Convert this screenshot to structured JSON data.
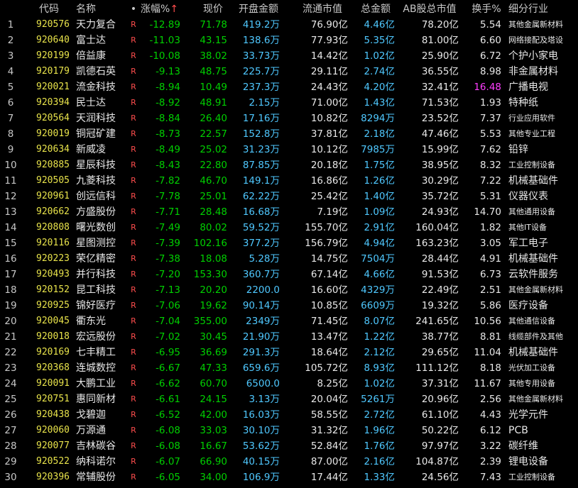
{
  "header": {
    "index": "",
    "code": "代码",
    "name": "名称",
    "dot": "•",
    "change_pct": "涨幅%",
    "change_arrow": "↑",
    "price": "现价",
    "open_amount": "开盘金额",
    "float_mv": "流通市值",
    "total_amount": "总金额",
    "ab_total_mv": "AB股总市值",
    "turnover": "换手%",
    "industry": "细分行业"
  },
  "colors": {
    "code": "#e8e34b",
    "down": "#00d000",
    "amount": "#4fc8ff",
    "neutral": "#e8e8e8",
    "rzrq_flag": "#ff4d4d",
    "highlight": "#ff3dff",
    "background": "#000000"
  },
  "rows": [
    {
      "idx": "1",
      "code": "920576",
      "name": "天力复合",
      "flag": "R",
      "chg": "-12.89",
      "price": "71.78",
      "open": "419.2万",
      "fmv": "76.90亿",
      "amt": "4.46亿",
      "abmv": "78.20亿",
      "turn": "5.54",
      "ind": "其他金属新材料"
    },
    {
      "idx": "2",
      "code": "920640",
      "name": "富士达",
      "flag": "R",
      "chg": "-11.03",
      "price": "43.15",
      "open": "138.6万",
      "fmv": "77.93亿",
      "amt": "5.35亿",
      "abmv": "81.00亿",
      "turn": "6.60",
      "ind": "网络接配及塔设"
    },
    {
      "idx": "3",
      "code": "920199",
      "name": "倍益康",
      "flag": "R",
      "chg": "-10.08",
      "price": "38.02",
      "open": "33.73万",
      "fmv": "14.42亿",
      "amt": "1.02亿",
      "abmv": "25.90亿",
      "turn": "6.72",
      "ind": "个护小家电"
    },
    {
      "idx": "4",
      "code": "920179",
      "name": "凯德石英",
      "flag": "R",
      "chg": "-9.13",
      "price": "48.75",
      "open": "225.7万",
      "fmv": "29.11亿",
      "amt": "2.74亿",
      "abmv": "36.55亿",
      "turn": "8.98",
      "ind": "非金属材料"
    },
    {
      "idx": "5",
      "code": "920021",
      "name": "流金科技",
      "flag": "R",
      "chg": "-8.94",
      "price": "10.49",
      "open": "237.3万",
      "fmv": "24.43亿",
      "amt": "4.20亿",
      "abmv": "32.41亿",
      "turn": "16.48",
      "ind": "广播电视"
    },
    {
      "idx": "6",
      "code": "920394",
      "name": "民士达",
      "flag": "R",
      "chg": "-8.92",
      "price": "48.91",
      "open": "2.15万",
      "fmv": "71.00亿",
      "amt": "1.43亿",
      "abmv": "71.53亿",
      "turn": "1.93",
      "ind": "特种纸"
    },
    {
      "idx": "7",
      "code": "920564",
      "name": "天润科技",
      "flag": "R",
      "chg": "-8.84",
      "price": "26.40",
      "open": "17.16万",
      "fmv": "10.82亿",
      "amt": "8294万",
      "abmv": "23.52亿",
      "turn": "7.37",
      "ind": "行业应用软件"
    },
    {
      "idx": "8",
      "code": "920019",
      "name": "铜冠矿建",
      "flag": "R",
      "chg": "-8.73",
      "price": "22.57",
      "open": "152.8万",
      "fmv": "37.81亿",
      "amt": "2.18亿",
      "abmv": "47.46亿",
      "turn": "5.53",
      "ind": "其他专业工程"
    },
    {
      "idx": "9",
      "code": "920634",
      "name": "新威凌",
      "flag": "R",
      "chg": "-8.49",
      "price": "25.02",
      "open": "31.23万",
      "fmv": "10.12亿",
      "amt": "7985万",
      "abmv": "15.99亿",
      "turn": "7.62",
      "ind": "铅锌"
    },
    {
      "idx": "10",
      "code": "920885",
      "name": "星辰科技",
      "flag": "R",
      "chg": "-8.43",
      "price": "22.80",
      "open": "87.85万",
      "fmv": "20.18亿",
      "amt": "1.75亿",
      "abmv": "38.95亿",
      "turn": "8.32",
      "ind": "工业控制设备"
    },
    {
      "idx": "11",
      "code": "920505",
      "name": "九菱科技",
      "flag": "R",
      "chg": "-7.82",
      "price": "46.70",
      "open": "149.1万",
      "fmv": "16.86亿",
      "amt": "1.26亿",
      "abmv": "30.29亿",
      "turn": "7.22",
      "ind": "机械基础件"
    },
    {
      "idx": "12",
      "code": "920961",
      "name": "创远信科",
      "flag": "R",
      "chg": "-7.78",
      "price": "25.01",
      "open": "62.22万",
      "fmv": "25.42亿",
      "amt": "1.40亿",
      "abmv": "35.72亿",
      "turn": "5.31",
      "ind": "仪器仪表"
    },
    {
      "idx": "13",
      "code": "920662",
      "name": "方盛股份",
      "flag": "R",
      "chg": "-7.71",
      "price": "28.48",
      "open": "16.68万",
      "fmv": "7.19亿",
      "amt": "1.09亿",
      "abmv": "24.93亿",
      "turn": "14.70",
      "ind": "其他通用设备"
    },
    {
      "idx": "14",
      "code": "920808",
      "name": "曙光数创",
      "flag": "R",
      "chg": "-7.49",
      "price": "80.02",
      "open": "59.52万",
      "fmv": "155.70亿",
      "amt": "2.91亿",
      "abmv": "160.04亿",
      "turn": "1.82",
      "ind": "其他IT设备"
    },
    {
      "idx": "15",
      "code": "920116",
      "name": "星图测控",
      "flag": "R",
      "chg": "-7.39",
      "price": "102.16",
      "open": "377.2万",
      "fmv": "156.79亿",
      "amt": "4.94亿",
      "abmv": "163.23亿",
      "turn": "3.05",
      "ind": "军工电子"
    },
    {
      "idx": "16",
      "code": "920223",
      "name": "荣亿精密",
      "flag": "R",
      "chg": "-7.38",
      "price": "18.08",
      "open": "5.28万",
      "fmv": "14.75亿",
      "amt": "7504万",
      "abmv": "28.44亿",
      "turn": "4.91",
      "ind": "机械基础件"
    },
    {
      "idx": "17",
      "code": "920493",
      "name": "并行科技",
      "flag": "R",
      "chg": "-7.20",
      "price": "153.30",
      "open": "360.7万",
      "fmv": "67.14亿",
      "amt": "4.66亿",
      "abmv": "91.53亿",
      "turn": "6.73",
      "ind": "云软件服务"
    },
    {
      "idx": "18",
      "code": "920152",
      "name": "昆工科技",
      "flag": "R",
      "chg": "-7.13",
      "price": "20.20",
      "open": "2200.0",
      "fmv": "16.60亿",
      "amt": "4329万",
      "abmv": "22.49亿",
      "turn": "2.51",
      "ind": "其他金属新材料"
    },
    {
      "idx": "19",
      "code": "920925",
      "name": "锦好医疗",
      "flag": "R",
      "chg": "-7.06",
      "price": "19.62",
      "open": "90.14万",
      "fmv": "10.85亿",
      "amt": "6609万",
      "abmv": "19.32亿",
      "turn": "5.86",
      "ind": "医疗设备"
    },
    {
      "idx": "20",
      "code": "920045",
      "name": "衢东光",
      "flag": "R",
      "chg": "-7.04",
      "price": "355.00",
      "open": "2349万",
      "fmv": "71.45亿",
      "amt": "8.07亿",
      "abmv": "241.65亿",
      "turn": "10.56",
      "ind": "其他通信设备"
    },
    {
      "idx": "21",
      "code": "920018",
      "name": "宏远股份",
      "flag": "R",
      "chg": "-7.02",
      "price": "30.45",
      "open": "21.90万",
      "fmv": "13.47亿",
      "amt": "1.22亿",
      "abmv": "38.77亿",
      "turn": "8.81",
      "ind": "线缆部件及其他"
    },
    {
      "idx": "22",
      "code": "920169",
      "name": "七丰精工",
      "flag": "R",
      "chg": "-6.95",
      "price": "36.69",
      "open": "291.3万",
      "fmv": "18.64亿",
      "amt": "2.12亿",
      "abmv": "29.65亿",
      "turn": "11.04",
      "ind": "机械基础件"
    },
    {
      "idx": "23",
      "code": "920368",
      "name": "连城数控",
      "flag": "R",
      "chg": "-6.67",
      "price": "47.33",
      "open": "659.6万",
      "fmv": "105.72亿",
      "amt": "8.93亿",
      "abmv": "111.12亿",
      "turn": "8.18",
      "ind": "光伏加工设备"
    },
    {
      "idx": "24",
      "code": "920091",
      "name": "大鹏工业",
      "flag": "R",
      "chg": "-6.62",
      "price": "60.70",
      "open": "6500.0",
      "fmv": "8.25亿",
      "amt": "1.02亿",
      "abmv": "37.31亿",
      "turn": "11.67",
      "ind": "其他专用设备"
    },
    {
      "idx": "25",
      "code": "920751",
      "name": "惠同新材",
      "flag": "R",
      "chg": "-6.61",
      "price": "24.15",
      "open": "3.13万",
      "fmv": "20.04亿",
      "amt": "5261万",
      "abmv": "20.96亿",
      "turn": "2.56",
      "ind": "其他金属新材料"
    },
    {
      "idx": "26",
      "code": "920438",
      "name": "戈碧迦",
      "flag": "R",
      "chg": "-6.52",
      "price": "42.00",
      "open": "16.03万",
      "fmv": "58.55亿",
      "amt": "2.72亿",
      "abmv": "61.10亿",
      "turn": "4.43",
      "ind": "光学元件"
    },
    {
      "idx": "27",
      "code": "920060",
      "name": "万源通",
      "flag": "R",
      "chg": "-6.08",
      "price": "33.03",
      "open": "30.10万",
      "fmv": "31.32亿",
      "amt": "1.96亿",
      "abmv": "50.22亿",
      "turn": "6.12",
      "ind": "PCB"
    },
    {
      "idx": "28",
      "code": "920077",
      "name": "吉林碳谷",
      "flag": "R",
      "chg": "-6.08",
      "price": "16.67",
      "open": "53.62万",
      "fmv": "52.84亿",
      "amt": "1.76亿",
      "abmv": "97.97亿",
      "turn": "3.22",
      "ind": "碳纤维"
    },
    {
      "idx": "29",
      "code": "920522",
      "name": "纳科诺尔",
      "flag": "R",
      "chg": "-6.07",
      "price": "66.90",
      "open": "40.15万",
      "fmv": "87.00亿",
      "amt": "2.16亿",
      "abmv": "104.87亿",
      "turn": "2.39",
      "ind": "锂电设备"
    },
    {
      "idx": "30",
      "code": "920396",
      "name": "常辅股份",
      "flag": "R",
      "chg": "-6.05",
      "price": "34.00",
      "open": "106.9万",
      "fmv": "17.44亿",
      "amt": "1.33亿",
      "abmv": "24.56亿",
      "turn": "7.43",
      "ind": "工业控制设备"
    }
  ]
}
